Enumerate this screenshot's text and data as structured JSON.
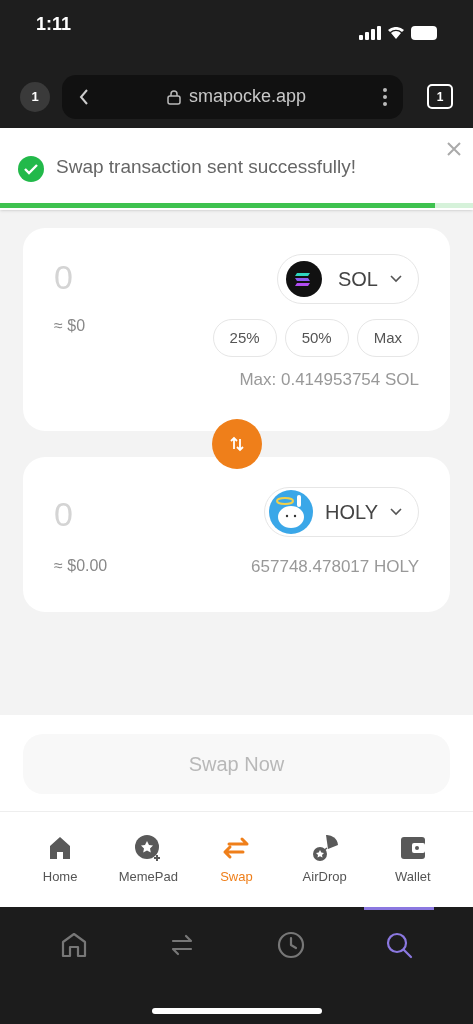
{
  "status_bar": {
    "time": "1:11"
  },
  "browser_bar": {
    "tab_badge": "1",
    "url": "smapocke.app",
    "tabs_count": "1"
  },
  "toast": {
    "message": "Swap transaction sent successfully!",
    "level": 0.92
  },
  "from": {
    "amount": "0",
    "usd": "≈ $0",
    "token": {
      "symbol": "SOL",
      "kind": "sol"
    },
    "presets": [
      {
        "label": "25%"
      },
      {
        "label": "50%"
      },
      {
        "label": "Max"
      }
    ],
    "max": "Max: 0.414953754 SOL"
  },
  "to": {
    "amount": "0",
    "usd": "≈ $0.00",
    "token": {
      "symbol": "HOLY",
      "kind": "holy"
    },
    "balance": "657748.478017 HOLY"
  },
  "swap_button": {
    "label": "Swap Now",
    "disabled": true
  },
  "nav": [
    {
      "label": "Home",
      "kind": "home",
      "selected": false
    },
    {
      "label": "MemePad",
      "kind": "memepad",
      "selected": false
    },
    {
      "label": "Swap",
      "kind": "swap",
      "selected": true
    },
    {
      "label": "AirDrop",
      "kind": "airdrop",
      "selected": false
    },
    {
      "label": "Wallet",
      "kind": "wallet",
      "selected": false
    }
  ],
  "browser_toolbar": [
    {
      "kind": "home",
      "selected": false
    },
    {
      "kind": "swap",
      "selected": false
    },
    {
      "kind": "history",
      "selected": false
    },
    {
      "kind": "search",
      "selected": true
    }
  ]
}
